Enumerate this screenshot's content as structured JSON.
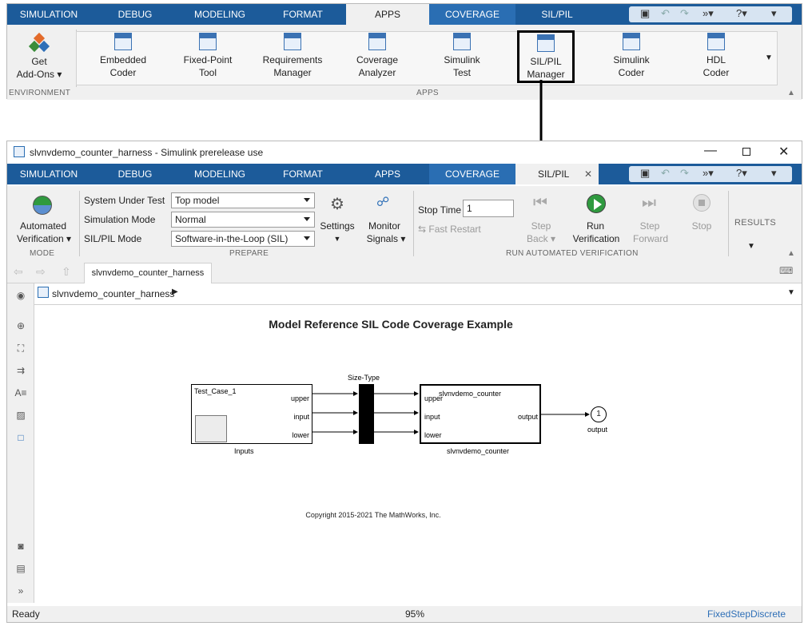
{
  "top": {
    "tabs": [
      "SIMULATION",
      "DEBUG",
      "MODELING",
      "FORMAT",
      "APPS",
      "COVERAGE",
      "SIL/PIL"
    ],
    "active_tab": "APPS",
    "env_app": {
      "label1": "Get",
      "label2": "Add-Ons"
    },
    "apps": [
      {
        "l1": "Embedded",
        "l2": "Coder",
        "icon": "C"
      },
      {
        "l1": "Fixed-Point",
        "l2": "Tool",
        "icon": ""
      },
      {
        "l1": "Requirements",
        "l2": "Manager",
        "icon": ""
      },
      {
        "l1": "Coverage",
        "l2": "Analyzer",
        "icon": ""
      },
      {
        "l1": "Simulink",
        "l2": "Test",
        "icon": ""
      },
      {
        "l1": "SIL/PIL",
        "l2": "Manager",
        "icon": ""
      },
      {
        "l1": "Simulink",
        "l2": "Coder",
        "icon": "C"
      },
      {
        "l1": "HDL",
        "l2": "Coder",
        "icon": "HDL"
      }
    ],
    "section_env": "ENVIRONMENT",
    "section_apps": "APPS"
  },
  "window": {
    "title": "slvnvdemo_counter_harness - Simulink prerelease use",
    "tabs": [
      "SIMULATION",
      "DEBUG",
      "MODELING",
      "FORMAT",
      "APPS",
      "COVERAGE",
      "SIL/PIL"
    ],
    "active_tab": "SIL/PIL",
    "mode": {
      "l1": "Automated",
      "l2": "Verification",
      "section": "MODE"
    },
    "prepare": {
      "sut_label": "System Under Test",
      "sut_value": "Top model",
      "sim_label": "Simulation Mode",
      "sim_value": "Normal",
      "silpil_label": "SIL/PIL Mode",
      "silpil_value": "Software-in-the-Loop (SIL)",
      "settings": "Settings",
      "monitor_l1": "Monitor",
      "monitor_l2": "Signals",
      "section": "PREPARE"
    },
    "run": {
      "stop_time_label": "Stop Time",
      "stop_time_value": "1",
      "fast_restart": "Fast Restart",
      "step_back_l1": "Step",
      "step_back_l2": "Back",
      "run_l1": "Run",
      "run_l2": "Verification",
      "step_fwd_l1": "Step",
      "step_fwd_l2": "Forward",
      "stop": "Stop",
      "section": "RUN AUTOMATED VERIFICATION"
    },
    "results": "RESULTS",
    "model_tab": "slvnvdemo_counter_harness",
    "breadcrumb": "slvnvdemo_counter_harness",
    "diagram": {
      "title": "Model Reference SIL Code Coverage Example",
      "test_case": "Test_Case_1",
      "inputs_label": "Inputs",
      "sizetype_label": "Size-Type",
      "ports": [
        "upper",
        "input",
        "lower"
      ],
      "model_name": "slvnvdemo_counter",
      "model_label": "slvnvdemo_counter",
      "out_port": "output",
      "outport_number": "1",
      "outport_label": "output",
      "copyright": "Copyright 2015-2021 The MathWorks, Inc."
    },
    "status": {
      "left": "Ready",
      "zoom": "95%",
      "solver": "FixedStepDiscrete"
    }
  }
}
